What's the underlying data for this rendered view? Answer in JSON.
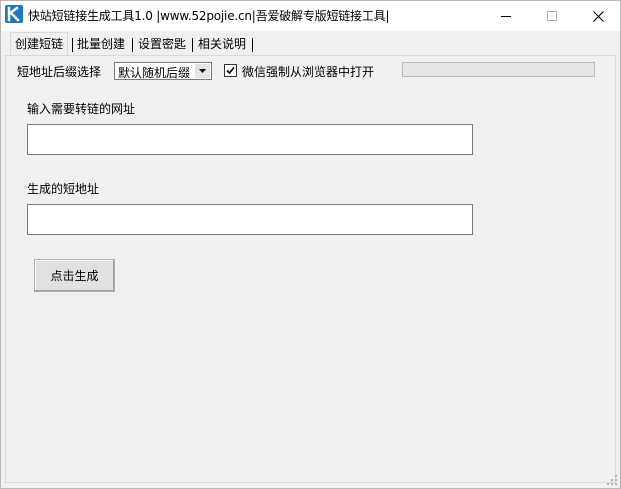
{
  "window": {
    "title": "快站短链接生成工具1.0 |www.52pojie.cn|吾爱破解专版短链接工具|",
    "app_icon_letter": "K",
    "icons": {
      "app": "app-logo-icon",
      "minimize": "minimize-icon",
      "maximize": "maximize-icon",
      "close": "close-icon"
    }
  },
  "tabs": [
    {
      "label": "创建短链",
      "active": true
    },
    {
      "label": "批量创建",
      "active": false
    },
    {
      "label": "设置密匙",
      "active": false
    },
    {
      "label": "相关说明",
      "active": false
    }
  ],
  "form": {
    "suffix_label": "短地址后缀选择",
    "suffix_selected": "默认随机后缀",
    "wechat_checkbox": {
      "label": "微信强制从浏览器中打开",
      "checked": true
    },
    "progress_percent": 0,
    "url_label": "输入需要转链的网址",
    "url_value": "",
    "short_label": "生成的短地址",
    "short_value": "",
    "generate_button": "点击生成"
  },
  "colors": {
    "accent": "#1e79c4",
    "window_bg": "#f0f0f0",
    "titlebar_bg": "#ffffff"
  }
}
